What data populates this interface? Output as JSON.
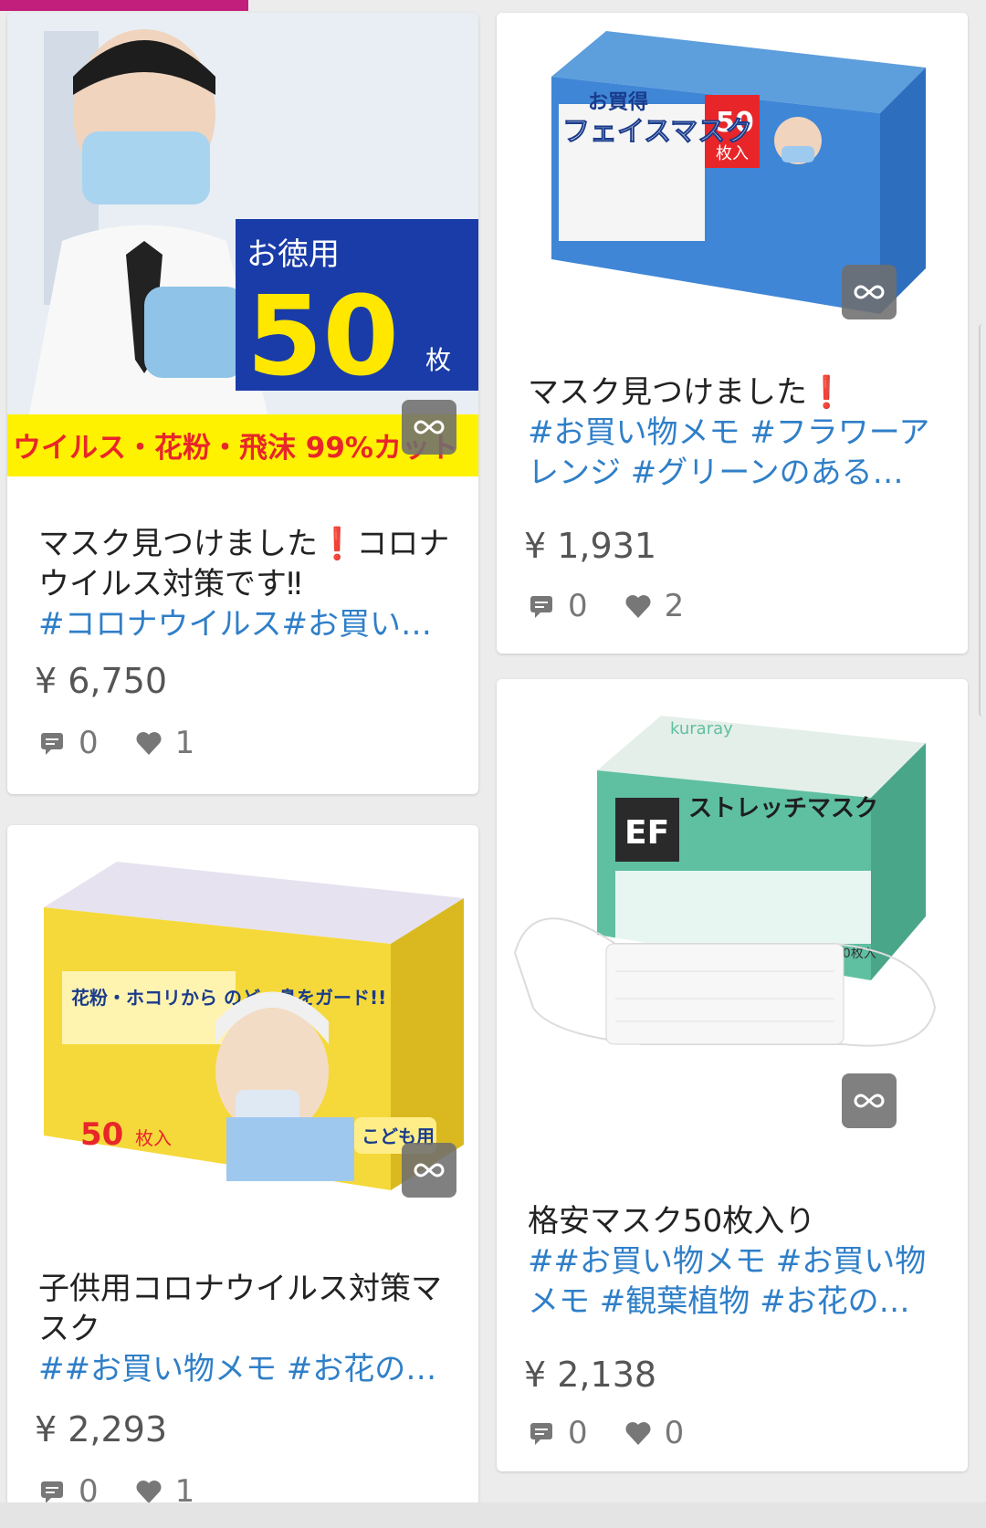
{
  "colors": {
    "accent_progress": "#c21e7c",
    "tag_blue": "#2f7fc8",
    "heart": "#777777",
    "exclaim_red": "#e02020"
  },
  "cards": [
    {
      "title": "マスク見つけました❗コロナウイルス対策です‼",
      "tags": "#コロナウイルス#お買い…",
      "price": "¥ 6,750",
      "comments": "0",
      "likes": "1",
      "image": {
        "label_top": "お徳用",
        "label_number": "50",
        "label_unit": "枚",
        "banner": "ウイルス・花粉・飛沫 99%カット"
      }
    },
    {
      "title": "マスク見つけました❗",
      "tags": "#お買い物メモ #フラワーアレンジ #グリーンのある…",
      "price": "¥ 1,931",
      "comments": "0",
      "likes": "2",
      "image": {
        "box_text": "フェイスマスク",
        "badge": "お買得",
        "count": "50",
        "count_unit": "枚入"
      }
    },
    {
      "title": "子供用コロナウイルス対策マスク",
      "tags": "##お買い物メモ #お花の…",
      "price": "¥ 2,293",
      "comments": "0",
      "likes": "1",
      "image": {
        "headline": "花粉・ホコリから のど・鼻をガード!!",
        "count": "50",
        "count_unit": "枚入",
        "kids_label": "こども用"
      }
    },
    {
      "title": "格安マスク50枚入り",
      "tags": "##お買い物メモ #お買い物メモ #観葉植物 #お花の…",
      "price": "¥ 2,138",
      "comments": "0",
      "likes": "0",
      "image": {
        "brand": "kuraray",
        "product": "ストレッチマスク",
        "code": "EF",
        "count": "50枚入"
      }
    }
  ],
  "icons": {
    "expand": "infinity-icon",
    "comment": "comment-icon",
    "like": "heart-icon"
  }
}
